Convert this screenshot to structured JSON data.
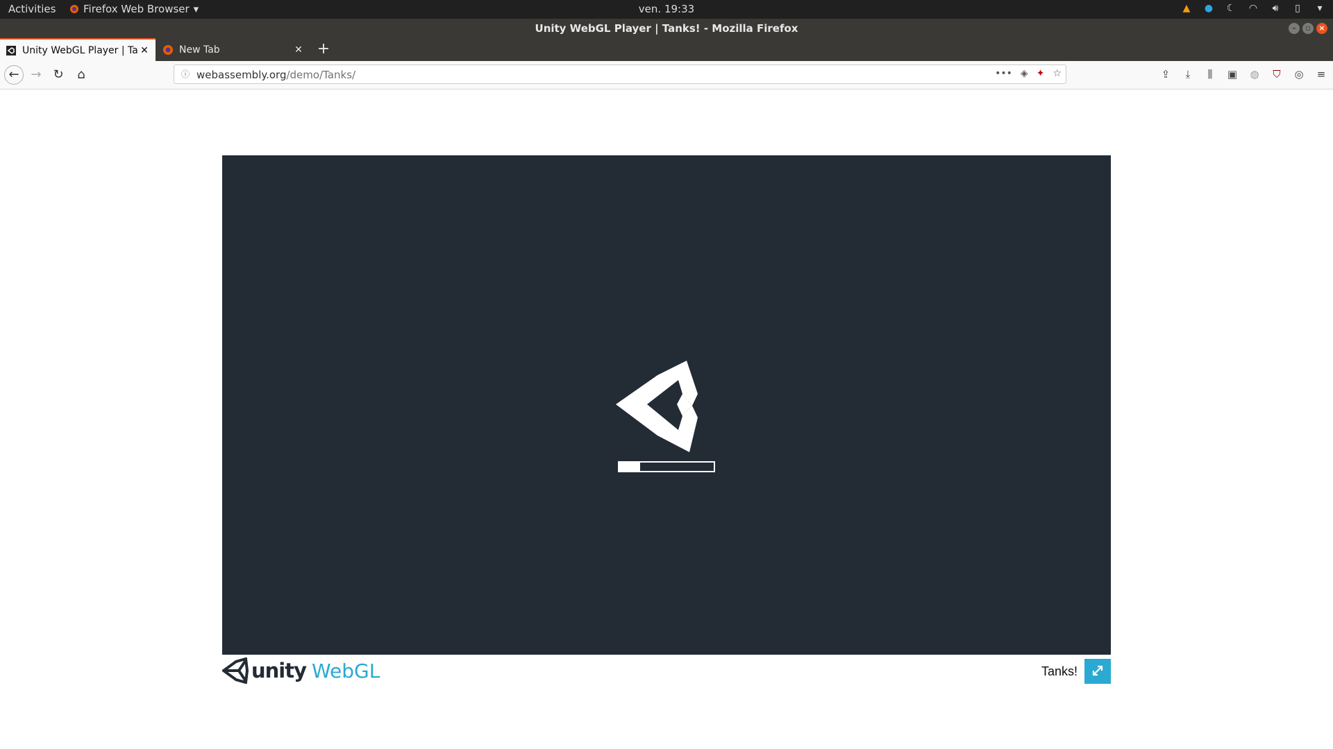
{
  "topbar": {
    "activities": "Activities",
    "app_menu": "Firefox Web Browser",
    "clock": "ven. 19:33"
  },
  "window": {
    "title": "Unity WebGL Player | Tanks! - Mozilla Firefox"
  },
  "tabs": [
    {
      "label": "Unity WebGL Player | Tanks!",
      "active": true,
      "icon": "unity-icon"
    },
    {
      "label": "New Tab",
      "active": false,
      "icon": "firefox-icon"
    }
  ],
  "urlbar": {
    "domain": "webassembly.org",
    "path": "/demo/Tanks/"
  },
  "player": {
    "loading_progress": 0.22,
    "footer_brand": "unity",
    "footer_product": "WebGL",
    "game_title": "Tanks!"
  },
  "colors": {
    "game_bg": "#232b35",
    "accent": "#2aa9d2",
    "ubuntu_orange": "#e95420"
  }
}
